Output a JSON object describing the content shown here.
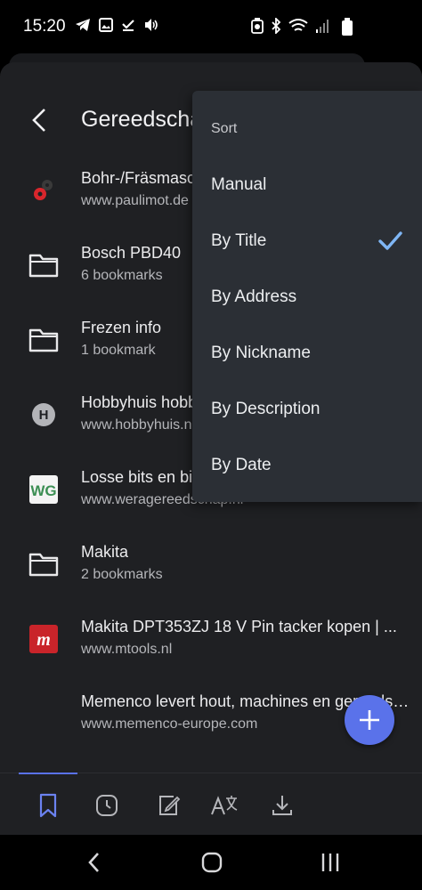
{
  "status": {
    "time": "15:20"
  },
  "app": {
    "title": "Gereedschap"
  },
  "bookmarks": [
    {
      "title": "Bohr-/Fräsmaschine",
      "subtitle": "www.paulimot.de",
      "icon": "paulimot-favicon"
    },
    {
      "title": "Bosch PBD40",
      "subtitle": "6 bookmarks",
      "icon": "folder-icon"
    },
    {
      "title": "Frezen info",
      "subtitle": "1 bookmark",
      "icon": "folder-icon"
    },
    {
      "title": "Hobbyhuis hobbyhuis",
      "subtitle": "www.hobbyhuis.nl",
      "icon": "letter-h-icon",
      "letter": "H"
    },
    {
      "title": "Losse bits en bitsets",
      "subtitle": "www.weragereedschap.nl",
      "icon": "wg-favicon",
      "letter": "WG"
    },
    {
      "title": "Makita",
      "subtitle": "2 bookmarks",
      "icon": "folder-icon"
    },
    {
      "title": "Makita DPT353ZJ 18 V Pin tacker kopen | ...",
      "subtitle": "www.mtools.nl",
      "icon": "mtools-favicon",
      "letter": "m"
    },
    {
      "title": "Memenco levert hout, machines en gereedschap",
      "subtitle": "www.memenco-europe.com",
      "icon": "none"
    }
  ],
  "sort_menu": {
    "header": "Sort",
    "options": [
      "Manual",
      "By Title",
      "By Address",
      "By Nickname",
      "By Description",
      "By Date"
    ],
    "selected": "By Title"
  },
  "colors": {
    "accent": "#5a72ea",
    "check": "#7fb6f5",
    "menu_bg": "#2b2f35",
    "sheet_bg": "#1f2023"
  }
}
